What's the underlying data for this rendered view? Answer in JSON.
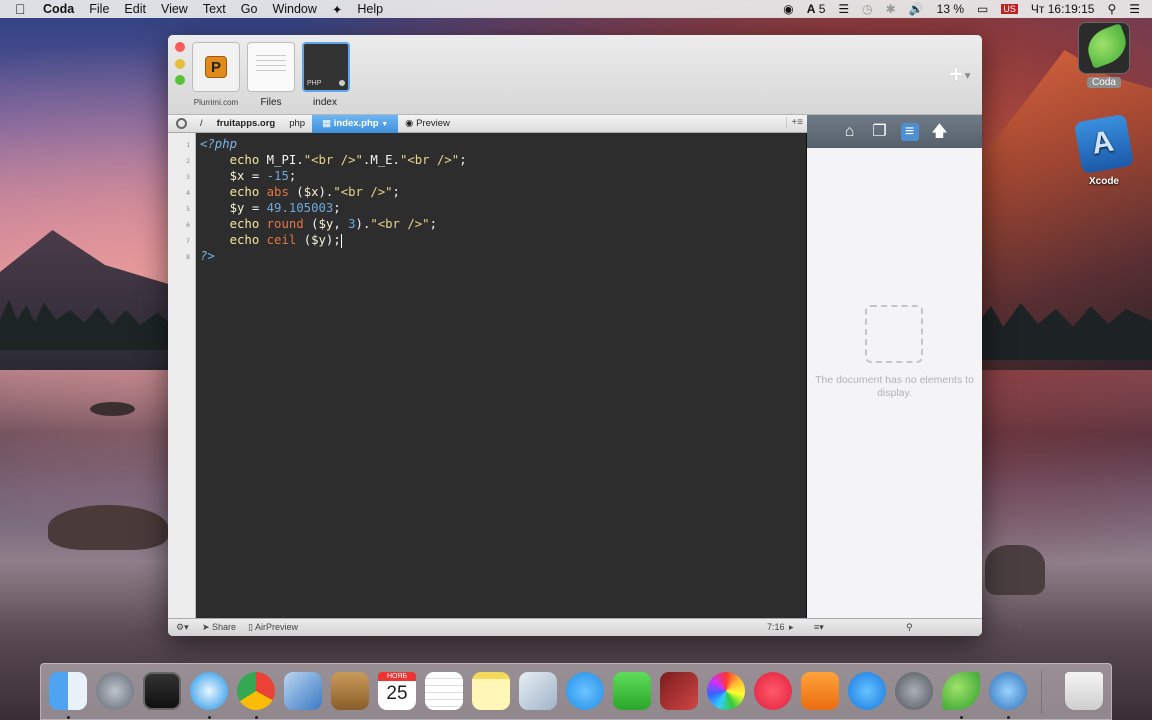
{
  "menubar": {
    "app": "Coda",
    "items": [
      "File",
      "Edit",
      "View",
      "Text",
      "Go",
      "Window",
      "Help"
    ],
    "status": {
      "input_indicator": "5",
      "battery": "13 %",
      "datetime": "Чт 16:19:15"
    }
  },
  "window": {
    "site_tabs": [
      {
        "label": "Plurrimi.com"
      },
      {
        "label": "Files"
      },
      {
        "label": "index"
      }
    ],
    "pathbar": {
      "root": "/",
      "crumbs": [
        "fruitapps.org",
        "php"
      ],
      "active_file": "index.php",
      "preview": "Preview"
    },
    "editor": {
      "line_numbers": [
        "1",
        "2",
        "3",
        "4",
        "5",
        "6",
        "7",
        "8"
      ],
      "lines": [
        "<?php",
        "echo M_PI.\"<br />\".M_E.\"<br />\";",
        "$x = -15;",
        "echo abs ($x).\"<br />\";",
        "$y = 49.105003;",
        "echo round ($y, 3).\"<br />\";",
        "echo ceil ($y);",
        "?>"
      ]
    },
    "side_panel": {
      "empty_message": "The document has no elements to display."
    },
    "statusbar": {
      "share": "Share",
      "airpreview": "AirPreview",
      "cursor_position": "7:16"
    }
  },
  "desktop": {
    "icons": [
      "Coda",
      "Xcode"
    ],
    "calendar_month": "НОЯБ",
    "calendar_day": "25"
  },
  "colors": {
    "editor_bg": "#2d2d2d",
    "keyword": "#f2e7a0",
    "function": "#e47446",
    "number": "#6fa8dc",
    "php_tag": "#79b3e6",
    "accent": "#3e8fd9"
  }
}
